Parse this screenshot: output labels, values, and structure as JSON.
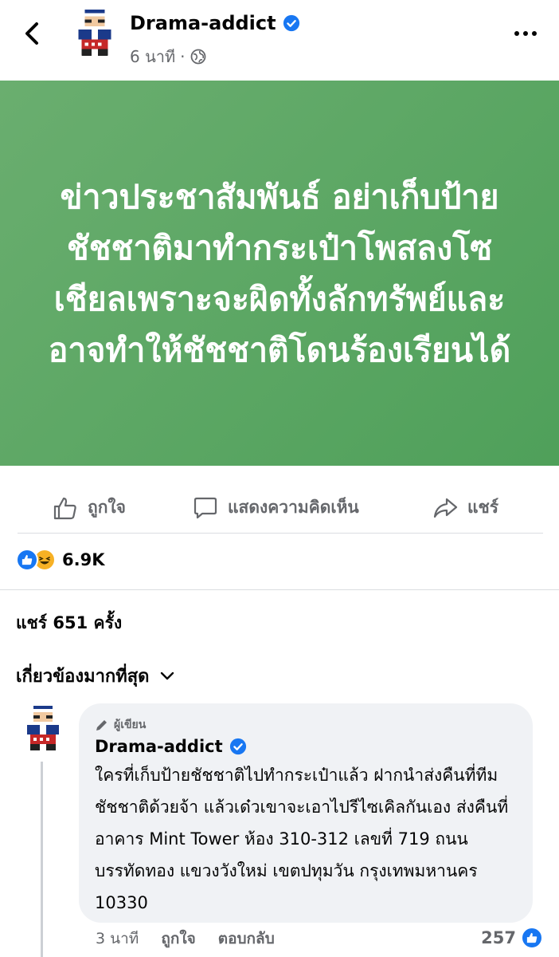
{
  "post": {
    "author": "Drama-addict",
    "time": "6 นาที",
    "audience_icon": "globe-icon",
    "banner_text": "ข่าวประชาสัมพันธ์ อย่าเก็บป้ายชัชชาติมาทำกระเป๋าโพสลงโซเชียลเพราะจะผิดทั้งลักทรัพย์และอาจทำให้ชัชชาติโดนร้องเรียนได้",
    "banner_color": "#5aa763"
  },
  "actions": {
    "like": "ถูกใจ",
    "comment": "แสดงความคิดเห็น",
    "share": "แชร์"
  },
  "reactions": {
    "count": "6.9K",
    "types": [
      "like",
      "haha"
    ]
  },
  "shares": "แชร์ 651 ครั้ง",
  "sort_label": "เกี่ยวข้องมากที่สุด",
  "comment": {
    "badge": "ผู้เขียน",
    "author": "Drama-addict",
    "text": "ใครที่เก็บป้ายชัชชาติไปทำกระเป๋าแล้ว ฝากนำส่งคืนที่ทีมชัชชาติด้วยจ้า แล้วเด๋วเขาจะเอาไปรีไซเคิลกันเอง ส่งคืนที่ อาคาร Mint Tower ห้อง 310-312 เลขที่ 719 ถนนบรรทัดทอง แขวงวังใหม่ เขตปทุมวัน กรุงเทพมหานคร 10330",
    "time": "3 นาที",
    "like": "ถูกใจ",
    "reply": "ตอบกลับ",
    "likes": "257"
  },
  "colors": {
    "accent": "#1877f2",
    "muted": "#65676b"
  }
}
